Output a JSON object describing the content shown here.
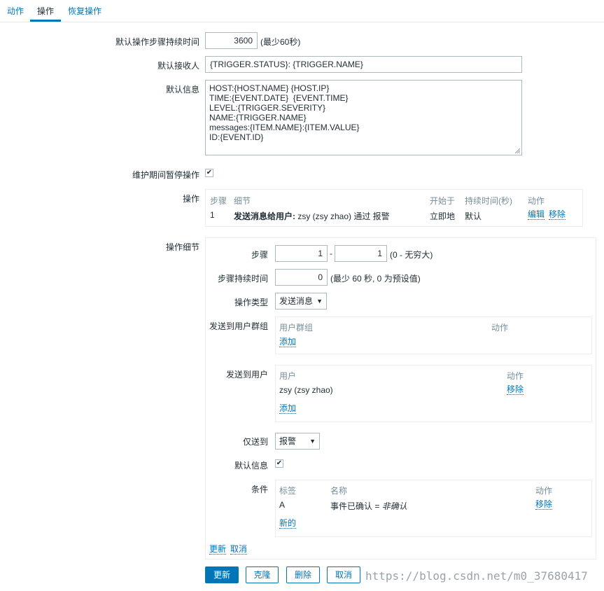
{
  "tabs": [
    {
      "label": "动作"
    },
    {
      "label": "操作"
    },
    {
      "label": "恢复操作"
    }
  ],
  "form": {
    "step_duration_label": "默认操作步骤持续时间",
    "step_duration_value": "3600",
    "step_duration_hint": "(最少60秒)",
    "subject_label": "默认接收人",
    "subject_value": "{TRIGGER.STATUS}: {TRIGGER.NAME}",
    "message_label": "默认信息",
    "message_value": "HOST:{HOST.NAME} {HOST.IP}\nTIME:{EVENT.DATE}  {EVENT.TIME}\nLEVEL:{TRIGGER.SEVERITY}\nNAME:{TRIGGER.NAME}\nmessages:{ITEM.NAME}:{ITEM.VALUE}\nID:{EVENT.ID}",
    "pause_label": "维护期间暂停操作",
    "pause_checked": true
  },
  "operations": {
    "label": "操作",
    "headers": [
      "步骤",
      "细节",
      "开始于",
      "持续时间(秒)",
      "动作"
    ],
    "rows": [
      {
        "step": "1",
        "detail_bold": "发送消息给用户:",
        "detail_rest": " zsy (zsy zhao) 通过 报警",
        "start": "立即地",
        "duration": "默认",
        "edit": "编辑",
        "remove": "移除"
      }
    ]
  },
  "details": {
    "label": "操作细节",
    "steps_label": "步骤",
    "step_from": "1",
    "step_dash": "-",
    "step_to": "1",
    "step_hint": "(0 - 无穷大)",
    "step_duration_label": "步骤持续时间",
    "step_duration_value": "0",
    "step_duration_hint": "(最少 60 秒, 0 为预设值)",
    "op_type_label": "操作类型",
    "op_type_value": "发送消息",
    "groups_label": "发送到用户群组",
    "groups_headers": [
      "用户群组",
      "动作"
    ],
    "groups_add": "添加",
    "users_label": "发送到用户",
    "users_headers": [
      "用户",
      "动作"
    ],
    "users_rows": [
      {
        "name": "zsy (zsy zhao)",
        "remove": "移除"
      }
    ],
    "users_add": "添加",
    "send_only_label": "仅送到",
    "send_only_value": "报警",
    "default_msg_label": "默认信息",
    "default_msg_checked": true,
    "conditions_label": "条件",
    "conditions_headers": [
      "标签",
      "名称",
      "动作"
    ],
    "conditions_rows": [
      {
        "tag": "A",
        "name": "事件已确认 = ",
        "name_italic": "非确认",
        "remove": "移除"
      }
    ],
    "conditions_new": "新的",
    "update_link": "更新",
    "cancel_link": "取消"
  },
  "buttons": {
    "update": "更新",
    "clone": "克隆",
    "delete": "删除",
    "cancel": "取消"
  },
  "watermark": "https://blog.csdn.net/m0_37680417"
}
